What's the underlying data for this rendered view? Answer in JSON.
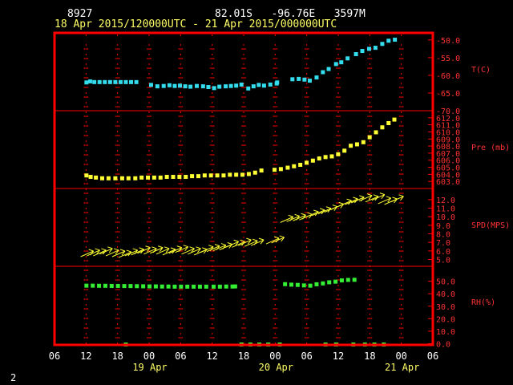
{
  "header": {
    "station_id": "8927",
    "location": "82.01S   -96.76E   3597M",
    "time_range": "18 Apr 2015/120000UTC - 21 Apr 2015/000000UTC"
  },
  "page_number": "2",
  "colors": {
    "background": "#000000",
    "frame": "#ff0000",
    "grid": "#ff0000",
    "temperature": "#33ddee",
    "pressure": "#ffff33",
    "wind": "#ffff33",
    "humidity": "#33ee33",
    "text_white": "#ffffff",
    "text_yellow": "#ffff66",
    "text_red": "#ff3333"
  },
  "chart_data": {
    "type": "scatter",
    "time_axis": {
      "tick_labels": [
        "06",
        "12",
        "18",
        "00",
        "06",
        "12",
        "18",
        "00",
        "06",
        "12",
        "18",
        "00",
        "06"
      ],
      "tick_hours": [
        -6,
        0,
        6,
        12,
        18,
        24,
        30,
        36,
        42,
        48,
        54,
        60,
        66
      ],
      "range_hours": [
        -6,
        66
      ],
      "date_labels": [
        {
          "text": "19 Apr",
          "hour": 12
        },
        {
          "text": "20 Apr",
          "hour": 36
        },
        {
          "text": "21 Apr",
          "hour": 60
        }
      ],
      "grid": true
    },
    "panels": [
      {
        "name": "temperature",
        "label": "T(C)",
        "range": [
          -70,
          -48
        ],
        "ticks": [
          "-50.0",
          "-55.0",
          "-60.0",
          "-65.0",
          "-70.0"
        ],
        "tick_values": [
          -50,
          -55,
          -60,
          -65,
          -70
        ],
        "series": [
          {
            "style": "square",
            "points": [
              [
                0,
                -61.9
              ],
              [
                0.7,
                -61.6
              ],
              [
                1.5,
                -61.8
              ],
              [
                2.5,
                -61.8
              ],
              [
                3.5,
                -61.8
              ],
              [
                4.5,
                -61.8
              ],
              [
                5.5,
                -61.8
              ],
              [
                6.5,
                -61.8
              ],
              [
                7.5,
                -61.8
              ],
              [
                8.5,
                -61.8
              ],
              [
                9.5,
                -61.8
              ],
              [
                12.3,
                -62.6
              ],
              [
                13.5,
                -63.0
              ],
              [
                14.7,
                -62.9
              ],
              [
                15.8,
                -62.7
              ],
              [
                16.8,
                -62.9
              ],
              [
                17.8,
                -62.8
              ],
              [
                18.8,
                -63.0
              ],
              [
                19.8,
                -63.1
              ],
              [
                21,
                -62.9
              ],
              [
                22.2,
                -63.0
              ],
              [
                23.2,
                -63.2
              ],
              [
                24.3,
                -63.5
              ],
              [
                25.3,
                -63.1
              ],
              [
                26.5,
                -63.0
              ],
              [
                27.5,
                -62.9
              ],
              [
                28.5,
                -62.8
              ],
              [
                29.5,
                -62.5
              ],
              [
                30.8,
                -63.6
              ],
              [
                31.8,
                -63.0
              ],
              [
                32.8,
                -62.6
              ],
              [
                33.8,
                -62.8
              ],
              [
                35,
                -62.5
              ],
              [
                36.2,
                -62.2
              ],
              [
                36.3,
                -61.9
              ],
              [
                39.2,
                -61.0
              ],
              [
                40.4,
                -60.9
              ],
              [
                41.5,
                -61.1
              ],
              [
                42.5,
                -61.4
              ],
              [
                43.8,
                -60.5
              ],
              [
                45,
                -59.0
              ],
              [
                46.1,
                -58.1
              ],
              [
                47.5,
                -56.7
              ],
              [
                48.5,
                -56.2
              ],
              [
                49.7,
                -55.1
              ],
              [
                51.3,
                -53.9
              ],
              [
                52.5,
                -53.0
              ],
              [
                53.8,
                -52.4
              ],
              [
                55,
                -52.1
              ],
              [
                56.3,
                -51.0
              ],
              [
                57.5,
                -50.1
              ],
              [
                58.7,
                -49.8
              ]
            ]
          }
        ]
      },
      {
        "name": "pressure",
        "label": "Pre (mb)",
        "range": [
          602,
          613
        ],
        "ticks": [
          "612.0",
          "611.0",
          "610.0",
          "609.0",
          "608.0",
          "607.0",
          "606.0",
          "605.0",
          "604.0",
          "603.0"
        ],
        "tick_values": [
          612,
          611,
          610,
          609,
          608,
          607,
          606,
          605,
          604,
          603
        ],
        "series": [
          {
            "style": "square",
            "points": [
              [
                0,
                603.9
              ],
              [
                0.8,
                603.7
              ],
              [
                1.8,
                603.6
              ],
              [
                3,
                603.5
              ],
              [
                4.2,
                603.5
              ],
              [
                5.5,
                603.5
              ],
              [
                6.8,
                603.5
              ],
              [
                8,
                603.5
              ],
              [
                9.3,
                603.5
              ],
              [
                10.5,
                603.6
              ],
              [
                11.7,
                603.6
              ],
              [
                12.9,
                603.6
              ],
              [
                14.1,
                603.6
              ],
              [
                15.3,
                603.7
              ],
              [
                16.5,
                603.7
              ],
              [
                17.7,
                603.7
              ],
              [
                18.9,
                603.7
              ],
              [
                20.1,
                603.8
              ],
              [
                21.3,
                603.8
              ],
              [
                22.5,
                603.9
              ],
              [
                23.7,
                603.9
              ],
              [
                24.9,
                603.9
              ],
              [
                26.1,
                603.9
              ],
              [
                27.3,
                604.0
              ],
              [
                28.5,
                604.0
              ],
              [
                29.7,
                604.0
              ],
              [
                30.9,
                604.1
              ],
              [
                32.1,
                604.3
              ],
              [
                33.3,
                604.6
              ],
              [
                35.8,
                604.7
              ],
              [
                37,
                604.8
              ],
              [
                38.3,
                605.0
              ],
              [
                39.5,
                605.2
              ],
              [
                40.7,
                605.4
              ],
              [
                41.9,
                605.7
              ],
              [
                43.1,
                606.0
              ],
              [
                44.3,
                606.3
              ],
              [
                45.5,
                606.5
              ],
              [
                46.7,
                606.6
              ],
              [
                47.9,
                606.9
              ],
              [
                49.1,
                607.4
              ],
              [
                50.3,
                608.1
              ],
              [
                51.5,
                608.3
              ],
              [
                52.7,
                608.6
              ],
              [
                53.9,
                609.3
              ],
              [
                55.1,
                610.0
              ],
              [
                56.3,
                610.7
              ],
              [
                57.5,
                611.3
              ],
              [
                58.6,
                611.8
              ]
            ]
          }
        ]
      },
      {
        "name": "wind",
        "label": "SPD(MPS)",
        "range": [
          4.2,
          13.3
        ],
        "ticks": [
          "12.0",
          "11.0",
          "10.0",
          "9.0",
          "8.0",
          "7.0",
          "6.0",
          "5.0"
        ],
        "tick_values": [
          12,
          11,
          10,
          9,
          8,
          7,
          6,
          5
        ],
        "series": [
          {
            "style": "wind_arrow",
            "points": [
              [
                0.2,
                5.7
              ],
              [
                1.4,
                5.8
              ],
              [
                2.6,
                5.8
              ],
              [
                3.8,
                6.0
              ],
              [
                5,
                5.8
              ],
              [
                6.2,
                5.7
              ],
              [
                7.4,
                5.6
              ],
              [
                8.6,
                5.8
              ],
              [
                9.8,
                5.9
              ],
              [
                11,
                6.1
              ],
              [
                12.2,
                6.0
              ],
              [
                13.4,
                6.1
              ],
              [
                14.6,
                6.0
              ],
              [
                15.8,
                5.9
              ],
              [
                17,
                6.1
              ],
              [
                18.2,
                6.2
              ],
              [
                19.4,
                6.0
              ],
              [
                20.6,
                6.0
              ],
              [
                21.8,
                5.9
              ],
              [
                23,
                6.2
              ],
              [
                24.2,
                6.3
              ],
              [
                25.4,
                6.4
              ],
              [
                26.6,
                6.5
              ],
              [
                27.8,
                6.8
              ],
              [
                29,
                6.8
              ],
              [
                30.2,
                7.0
              ],
              [
                31.4,
                6.9
              ],
              [
                32.6,
                7.0
              ],
              [
                35.5,
                7.2
              ],
              [
                36.5,
                7.3
              ],
              [
                38.2,
                9.7
              ],
              [
                39.4,
                9.8
              ],
              [
                40.6,
                9.9
              ],
              [
                41.8,
                10.0
              ],
              [
                43,
                10.3
              ],
              [
                44.2,
                10.5
              ],
              [
                45.4,
                10.7
              ],
              [
                46.6,
                10.9
              ],
              [
                47.8,
                11.2
              ],
              [
                49.3,
                11.6
              ],
              [
                50.5,
                11.8
              ],
              [
                51.7,
                12.0
              ],
              [
                53.2,
                12.2
              ],
              [
                54.4,
                12.1
              ],
              [
                55.6,
                12.3
              ],
              [
                56.8,
                11.9
              ],
              [
                58,
                11.8
              ],
              [
                59.2,
                12.1
              ]
            ]
          }
        ]
      },
      {
        "name": "humidity",
        "label": "RH(%)",
        "range": [
          -1,
          62
        ],
        "ticks": [
          "50.0",
          "40.0",
          "30.0",
          "20.0",
          "10.0",
          "0.0"
        ],
        "tick_values": [
          50,
          40,
          30,
          20,
          10,
          0
        ],
        "series": [
          {
            "style": "square",
            "points": [
              [
                0,
                46.8
              ],
              [
                1.2,
                46.8
              ],
              [
                2.4,
                46.7
              ],
              [
                3.6,
                46.7
              ],
              [
                4.8,
                46.6
              ],
              [
                6,
                46.6
              ],
              [
                7.2,
                46.5
              ],
              [
                8.4,
                46.5
              ],
              [
                9.6,
                46.4
              ],
              [
                10.8,
                46.3
              ],
              [
                12,
                46.2
              ],
              [
                13.2,
                46.2
              ],
              [
                14.4,
                46.1
              ],
              [
                15.6,
                46.1
              ],
              [
                16.8,
                46.0
              ],
              [
                18,
                46.0
              ],
              [
                19.2,
                46.0
              ],
              [
                20.4,
                46.0
              ],
              [
                21.6,
                46.0
              ],
              [
                22.8,
                46.0
              ],
              [
                24.2,
                46.0
              ],
              [
                25.4,
                46.0
              ],
              [
                26.6,
                46.1
              ],
              [
                27.8,
                46.1
              ],
              [
                28.3,
                46.2
              ],
              [
                37.8,
                48.0
              ],
              [
                39,
                47.6
              ],
              [
                40.2,
                47.4
              ],
              [
                41.4,
                47.0
              ],
              [
                42.6,
                46.8
              ],
              [
                43.8,
                47.9
              ],
              [
                45,
                48.6
              ],
              [
                46.2,
                49.5
              ],
              [
                47.4,
                50.0
              ],
              [
                48.6,
                51.0
              ],
              [
                49.8,
                51.4
              ],
              [
                51,
                51.5
              ]
            ]
          },
          {
            "style": "baseline_marker",
            "points": [
              [
                7.5,
                0
              ],
              [
                29.5,
                0
              ],
              [
                31.2,
                0
              ],
              [
                32.9,
                0
              ],
              [
                34.6,
                0
              ],
              [
                36.8,
                0
              ],
              [
                45.5,
                0
              ],
              [
                47.5,
                0
              ],
              [
                50.8,
                0
              ],
              [
                53,
                0
              ],
              [
                54.8,
                0
              ],
              [
                56.6,
                0
              ]
            ]
          }
        ]
      }
    ]
  }
}
